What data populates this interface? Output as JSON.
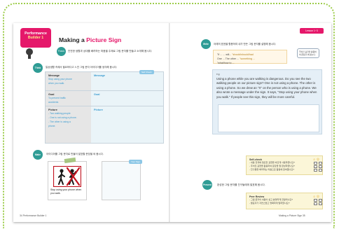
{
  "colors": {
    "brand": "#e5186a",
    "teal": "#2f9c95",
    "blue": "#3a9bd0",
    "frame": "#9ccc4a"
  },
  "left_page": {
    "badge_line1": "Performance",
    "badge_line2": "Builder 1",
    "title_prefix": "Making a ",
    "title_accent": "Picture Sign",
    "focus_label": "Focus",
    "intro": "안전한 생활과 상대를 배려하는 마음을 주제로 그림 문자를 만들고 소개해 봅시다.",
    "think_label": "Think",
    "think_text": "일상생활 속에서 필요하다고 느낀 그림 문자 아이디어를 생각해 봅시다.",
    "table": {
      "tag_label": "Self Check",
      "rows": [
        {
          "left_head": "Message",
          "left_sub": [
            "Stop using your phone",
            "when you walk."
          ],
          "right_head": "Message"
        },
        {
          "left_head": "Goal",
          "left_sub": [
            "To prevent traffic",
            "accidents"
          ],
          "right_head": "Goal"
        },
        {
          "left_head": "Picture",
          "left_sub": [
            "- Two walking people",
            "- One is not using a phone.",
            "- The other is using a",
            "  phone."
          ],
          "right_head": "Picture"
        }
      ]
    },
    "make_label": "Make",
    "make_text": "아이디어를 그림 문자로 만들어 발표할 문장을 써 봅시다.",
    "sign_caption": "Stop using your phone when you walk.",
    "blank_tag": "Your Sign",
    "footer": "34  Performance Builder 1"
  },
  "right_page": {
    "lesson_tag": "Lesson 1~3",
    "write_label": "Write",
    "write_text": "아래의 표현을 활용하여 내가 만든 그림 문자를 설명해 봅시다.",
    "fill_lines": [
      {
        "text": "\"If ... ... will...",
        "opt": "\"should/should/had"
      },
      {
        "text": "One ...  The other ...",
        "opt": "\"something ..."
      },
      {
        "text": "\"what/how to ...",
        "opt": ""
      }
    ],
    "tip_text": "주어진 표현을 활용하여 문장을 써 봅시다.",
    "passage_label": "e.g.",
    "passage": "Using a phone while you are walking is dangerous. Do you see the two walking people on our picture sign? One is not using a phone. The other is using a phone. So we drew an \"X\" on the person who is using a phone. We also wrote a message under the sign. It says, \"Stop using your phone when you walk.\" If people see this sign, they will be more careful.",
    "self_check": {
      "title": "Self-check",
      "items": [
        "- 내용 전개에 필요한 표현을 바르게 사용하였나요?",
        "- 주어진 표현을 활용하여 문장을 잘 완성하였나요?",
        "- 친구들을 배려하는 마음으로 활동에 참여했나요?"
      ]
    },
    "present_label": "Present",
    "present_text": "완성한 그림 문자를 친구들에게 발표해 봅시다.",
    "peer_review": {
      "title": "Peer Review",
      "items": [
        "- 그림 문자의 내용이 쉽고 분명하게 전달되나요?",
        "- 발표자가 자연스럽고 명확하게 말하였나요?"
      ]
    },
    "footer": "Making a Picture Sign  35"
  }
}
